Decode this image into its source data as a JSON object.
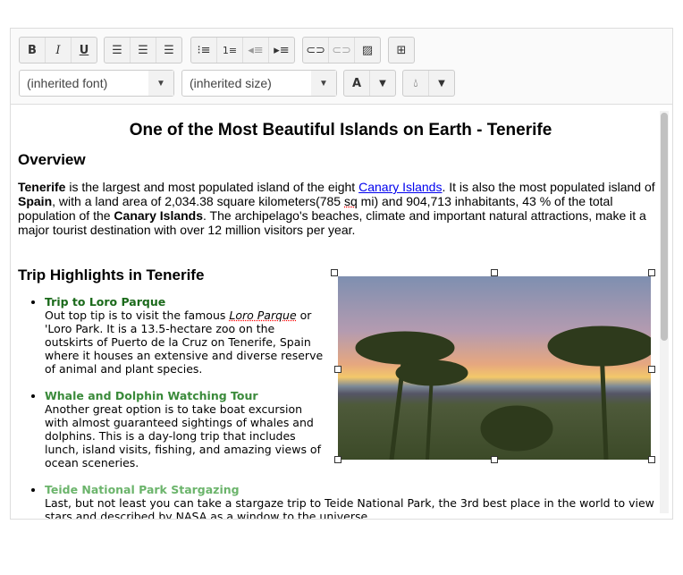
{
  "toolbar": {
    "format": [
      {
        "icon": "bold-icon",
        "label": "B"
      },
      {
        "icon": "italic-icon",
        "label": "I"
      },
      {
        "icon": "underline-icon",
        "label": "U"
      }
    ],
    "align": [
      "align-left-icon",
      "align-center-icon",
      "align-right-icon"
    ],
    "lists": [
      "bulleted-list-icon",
      "numbered-list-icon",
      "outdent-icon",
      "indent-icon"
    ],
    "insert": [
      "link-icon",
      "unlink-icon",
      "image-icon"
    ],
    "table": "insert-table-icon",
    "font_select": "(inherited font)",
    "size_select": "(inherited size)",
    "font_color_label": "A"
  },
  "content": {
    "title": "One of the Most Beautiful Islands on Earth - Tenerife",
    "overview_heading": "Overview",
    "overview": {
      "b1": "Tenerife",
      "t1": " is the largest and most populated island of the eight ",
      "link": "Canary Islands",
      "t2": ". It is also the most populated island of ",
      "b2": "Spain",
      "t3": ", with a land area of 2,034.38 square kilometers(785 ",
      "sq": "sq",
      "t4": " mi) and 904,713 inhabitants, 43 % of the total population of the ",
      "b3": "Canary Islands",
      "t5": ". The archipelago's beaches, climate and important natural attractions, make it a major tourist destination with over 12 million visitors per year."
    },
    "highlights_heading": "Trip Highlights in Tenerife",
    "items": [
      {
        "title": "Trip to Loro Parque",
        "color": "#1b6a1b",
        "a": "Out top tip is to visit the famous ",
        "i": "Loro Parque",
        "b": " or 'Loro Park. It is a 13.5-hectare zoo on the outskirts of Puerto de la Cruz on Tenerife, Spain where it houses an extensive and diverse reserve of animal and plant species."
      },
      {
        "title": "Whale and Dolphin Watching Tour",
        "color": "#3a8a3a",
        "a": "Another great option is to take boat excursion with almost guaranteed sightings of whales and dolphins. This is a day-long trip that includes lunch, island visits, fishing, and amazing views of ocean sceneries."
      },
      {
        "title": "Teide National Park Stargazing",
        "color": "#6bb46b",
        "a": "Last, but not least you can take a stargaze trip to Teide National Park, the 3rd best place in the world to view stars and described by NASA as a window to the universe."
      }
    ]
  }
}
